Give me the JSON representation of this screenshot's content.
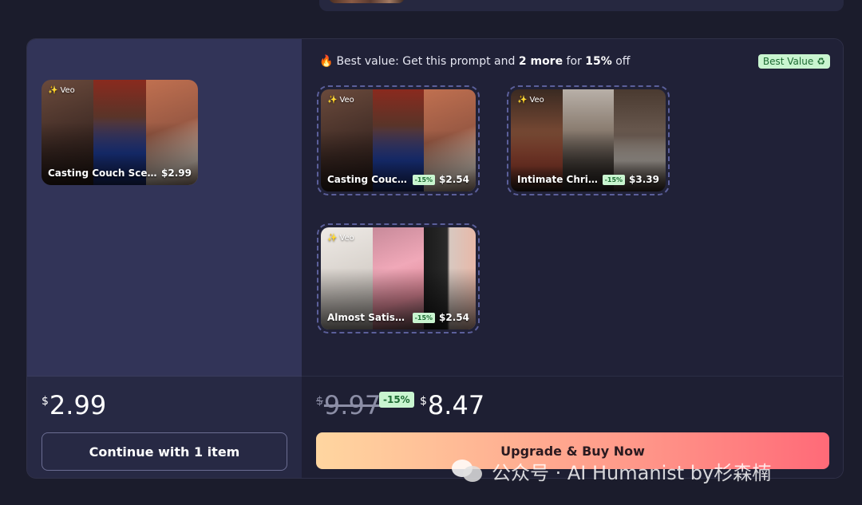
{
  "offer": {
    "fire_icon": "fire-icon",
    "text_before": "Best value: Get this prompt and ",
    "count_text": "2 more",
    "text_mid": " for ",
    "percent_text": "15%",
    "text_after": " off",
    "badge_label": "Best Value",
    "badge_icon": "recycle-icon"
  },
  "selected_item": {
    "model": "Veo",
    "title": "Casting Couch Scene Ge...",
    "price": "$2.99"
  },
  "bundle_items": [
    {
      "model": "Veo",
      "title": "Casting Couch Sce...",
      "discount": "-15%",
      "price": "$2.54"
    },
    {
      "model": "Veo",
      "title": "Intimate Christma...",
      "discount": "-15%",
      "price": "$3.39"
    },
    {
      "model": "Veo",
      "title": "Almost Satisfying ...",
      "discount": "-15%",
      "price": "$2.54"
    }
  ],
  "left_footer": {
    "currency": "$",
    "amount": "2.99",
    "button_label": "Continue with 1 item"
  },
  "right_footer": {
    "currency": "$",
    "old_amount": "9.97",
    "discount": "-15%",
    "new_amount": "8.47",
    "button_label": "Upgrade & Buy Now"
  },
  "watermark": {
    "icon": "wechat-icon",
    "text": "公众号 · AI Humanist by杉森楠"
  },
  "colors": {
    "background": "#1b1c2c",
    "left_panel": "#323458",
    "discount_badge_bg": "#c9f5d0",
    "discount_badge_text": "#1d6b33",
    "cta_gradient_start": "#ffd6a0",
    "cta_gradient_end": "#ff6a78"
  }
}
